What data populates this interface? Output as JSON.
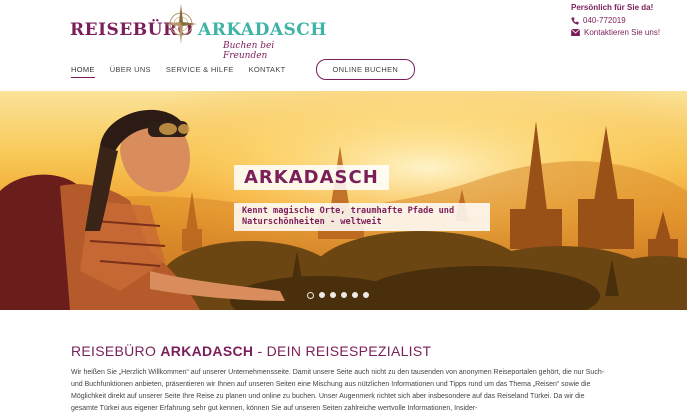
{
  "brand": {
    "name_left": "REISEBÜRO",
    "name_right": "ARKADASCH",
    "tagline": "Buchen bei Freunden"
  },
  "contact": {
    "title": "Persönlich für Sie da!",
    "phone": "040-772019",
    "email_label": "Kontaktieren Sie uns!"
  },
  "nav": {
    "items": [
      {
        "label": "HOME",
        "active": true
      },
      {
        "label": "ÜBER UNS",
        "active": false
      },
      {
        "label": "SERVICE & HILFE",
        "active": false
      },
      {
        "label": "KONTAKT",
        "active": false
      }
    ],
    "cta": "ONLINE BUCHEN"
  },
  "hero": {
    "title": "ARKADASCH",
    "subtitle": "Kennt magische Orte, traumhafte Pfade und Naturschönheiten - weltweit",
    "slides": 6,
    "active_slide": 1
  },
  "intro": {
    "title_prefix": "REISEBÜRO",
    "title_bold": "ARKADASCH",
    "title_suffix": " - DEIN REISESPEZIALIST",
    "text": "Wir heißen Sie „Herzlich Willkommen“ auf unserer Unternehmensseite. Damit unsere Seite auch nicht zu den tausenden von anonymen Reiseportalen gehört, die nur Such- und Buchfunktionen anbieten, präsentieren wir Ihnen auf unseren Seiten eine Mischung aus nützlichen Informationen und Tipps rund um das Thema „Reisen“ sowie die Möglichkeit direkt auf unserer Seite Ihre Reise zu planen und online zu buchen. Unser Augenmerk richtet sich aber insbesondere auf das Reiseland Türkei. Da wir die gesamte Türkei aus eigener Erfahrung sehr gut kennen, können Sie auf unseren Seiten zahlreiche wertvolle Informationen, Insider-"
  },
  "colors": {
    "brand_purple": "#7b1f5a",
    "brand_teal": "#3eb3a6"
  }
}
